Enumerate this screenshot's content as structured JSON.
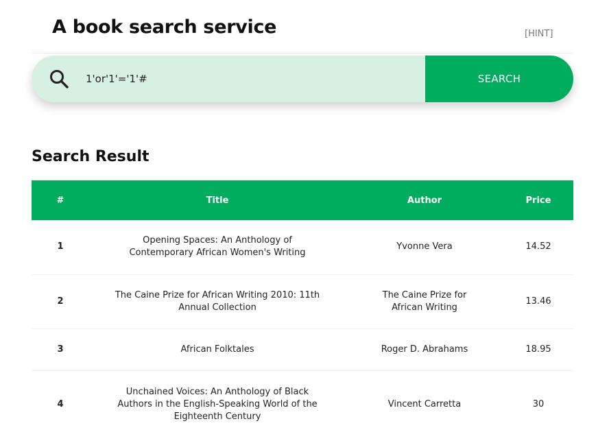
{
  "page": {
    "title": "A book search service",
    "hint_link": "[HINT]"
  },
  "search": {
    "query": "1'or'1'='1'#",
    "button_label": "SEARCH",
    "icon": "search-icon"
  },
  "results": {
    "heading": "Search Result",
    "columns": [
      "#",
      "Title",
      "Author",
      "Price"
    ],
    "rows": [
      {
        "num": "1",
        "title": "Opening Spaces: An Anthology of Contemporary African Women's Writing",
        "author": "Yvonne Vera",
        "price": "14.52"
      },
      {
        "num": "2",
        "title": "The Caine Prize for African Writing 2010: 11th Annual Collection",
        "author": "The Caine Prize for African Writing",
        "price": "13.46"
      },
      {
        "num": "3",
        "title": "African Folktales",
        "author": "Roger D. Abrahams",
        "price": "18.95"
      },
      {
        "num": "4",
        "title": "Unchained Voices: An Anthology of Black Authors in the English-Speaking World of the Eighteenth Century",
        "author": "Vincent Carretta",
        "price": "30"
      }
    ]
  },
  "colors": {
    "accent": "#00ad5f",
    "search_field_bg": "#d8f0e1"
  }
}
